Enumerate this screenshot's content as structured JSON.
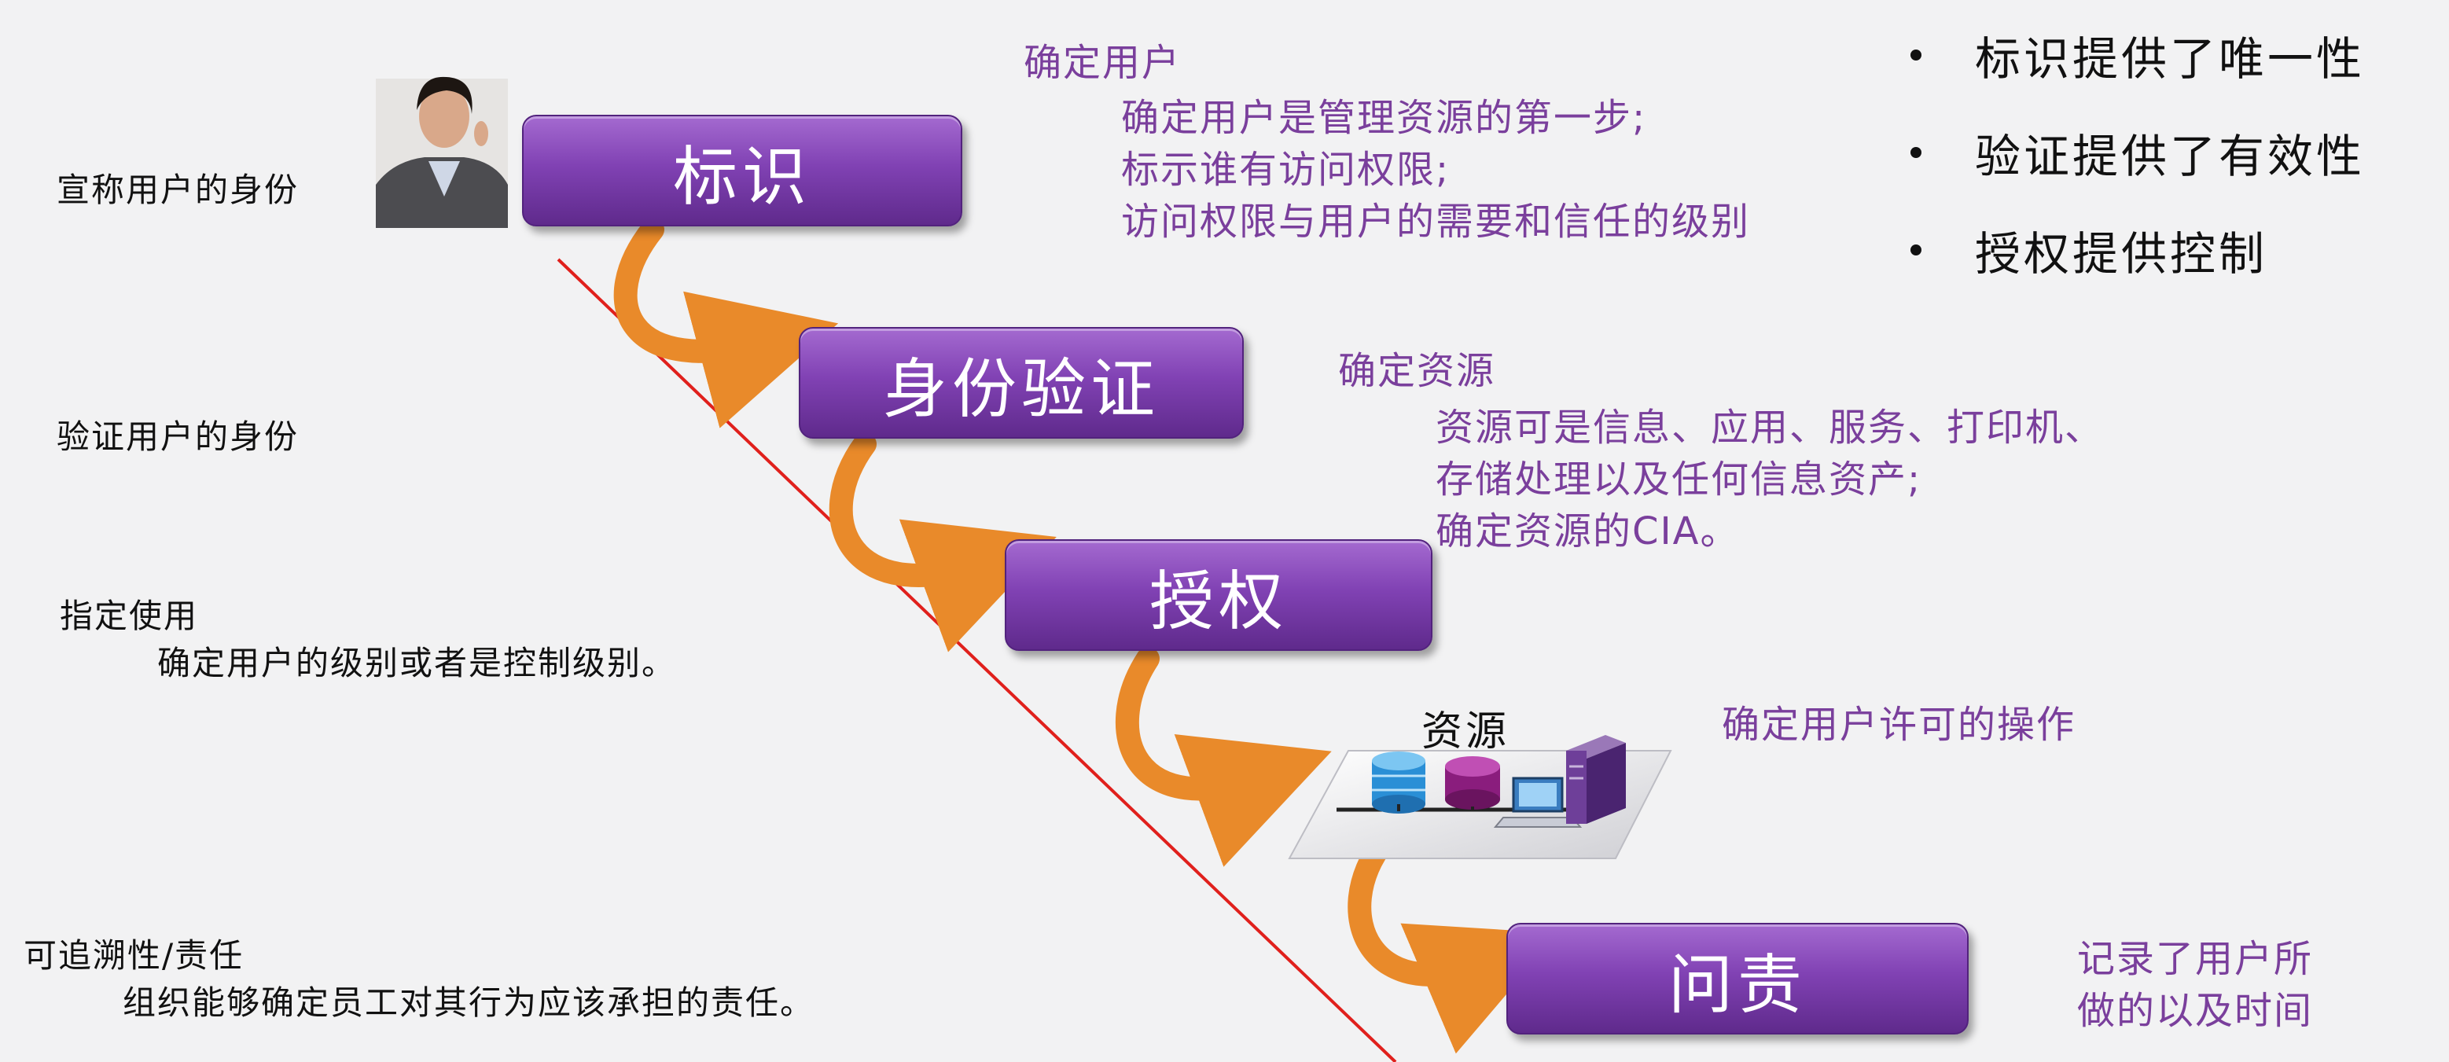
{
  "left": {
    "claim": "宣称用户的身份",
    "verify": "验证用户的身份",
    "assign_title": "指定使用",
    "assign_detail": "确定用户的级别或者是控制级别。",
    "trace_title": "可追溯性/责任",
    "trace_detail": "组织能够确定员工对其行为应该承担的责任。"
  },
  "steps": {
    "identify": "标识",
    "authenticate": "身份验证",
    "authorize": "授权",
    "resource": "资源",
    "accountability": "问责"
  },
  "notes": {
    "user_title": "确定用户",
    "user_lines": [
      "确定用户是管理资源的第一步;",
      "标示谁有访问权限;",
      "访问权限与用户的需要和信任的级别"
    ],
    "resource_title": "确定资源",
    "resource_lines": [
      "资源可是信息、应用、服务、打印机、",
      "存储处理以及任何信息资产;",
      "确定资源的CIA。"
    ],
    "operation": "确定用户许可的操作",
    "record_lines": [
      "记录了用户所",
      "做的以及时间"
    ]
  },
  "bullets": [
    "标识提供了唯一性",
    "验证提供了有效性",
    "授权提供控制"
  ],
  "colors": {
    "box_purple": "#8142b4",
    "text_purple": "#7a3f9c",
    "arrow_orange": "#e98a2a",
    "red_line": "#e0201c"
  },
  "icons": [
    "person-photo-icon",
    "database-icon",
    "computer-icon",
    "server-icon"
  ]
}
